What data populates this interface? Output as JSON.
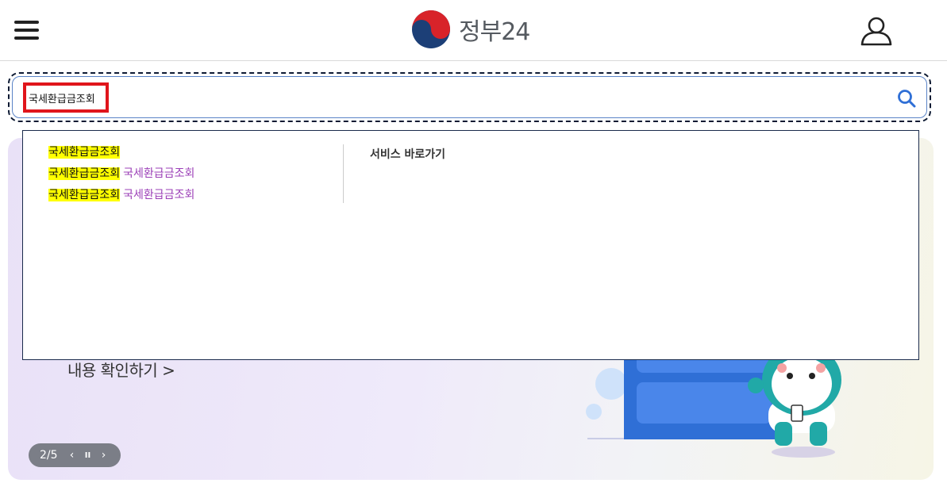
{
  "header": {
    "logo_text": "정부24"
  },
  "search": {
    "value": "국세환급금조회"
  },
  "suggestions": {
    "items": [
      {
        "match": "국세환급금조회",
        "category": ""
      },
      {
        "match": "국세환급금조회",
        "category": "국세환급금조회"
      },
      {
        "match": "국세환급금조회",
        "category": "국세환급금조회"
      }
    ],
    "service_title": "서비스 바로가기"
  },
  "banner": {
    "link_text": "내용 확인하기 >",
    "slide_counter": "2/5"
  },
  "colors": {
    "highlight": "#ffff00",
    "category": "#9b3fb7",
    "accent_blue": "#2f6fd6",
    "focus_box": "#e0151b"
  }
}
